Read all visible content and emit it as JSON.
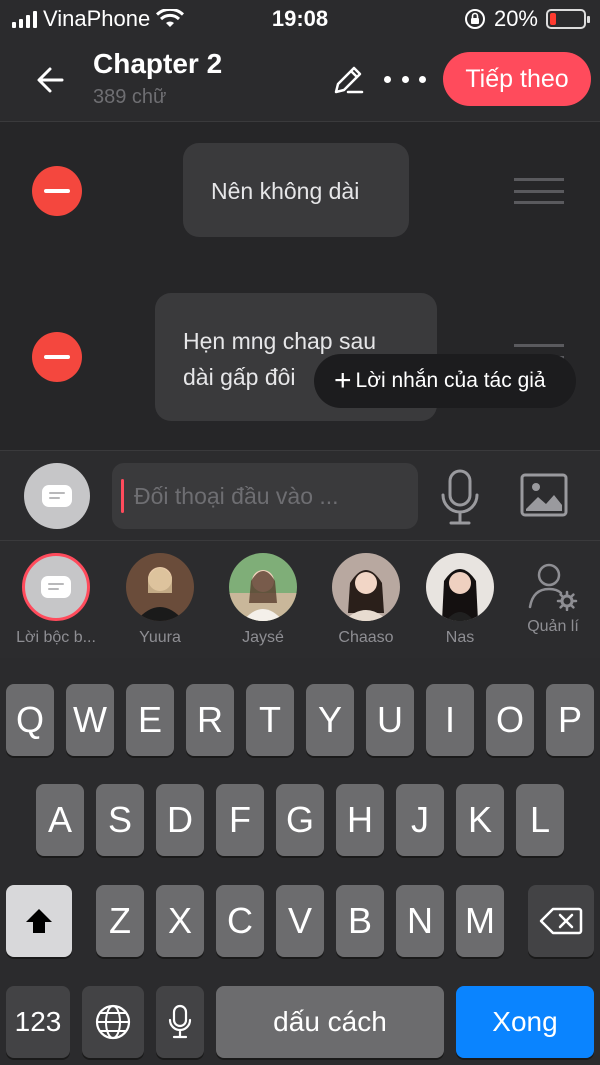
{
  "status_bar": {
    "carrier": "VinaPhone",
    "time": "19:08",
    "battery": "20%",
    "battery_level": 0.2,
    "colors": {
      "battery_low": "#ff3b30"
    }
  },
  "header": {
    "title": "Chapter 2",
    "word_count": "389 chữ",
    "next_label": "Tiếp theo",
    "accent": "#ff4b5c"
  },
  "messages": [
    {
      "text": "Nên không dài"
    },
    {
      "line1": "Hẹn mng chap sau",
      "line2": "dài gấp đôi"
    }
  ],
  "tooltip": {
    "plus": "+",
    "label": "Lời nhắn của tác giả"
  },
  "composer": {
    "placeholder": "Đối thoại đầu vào ..."
  },
  "characters": [
    {
      "name": "Lời bộc b..."
    },
    {
      "name": "Yuura"
    },
    {
      "name": "Jaysé"
    },
    {
      "name": "Chaaso"
    },
    {
      "name": "Nas"
    }
  ],
  "manage_label": "Quản lí",
  "keyboard": {
    "row1": [
      "Q",
      "W",
      "E",
      "R",
      "T",
      "Y",
      "U",
      "I",
      "O",
      "P"
    ],
    "row2": [
      "A",
      "S",
      "D",
      "F",
      "G",
      "H",
      "J",
      "K",
      "L"
    ],
    "row3": [
      "Z",
      "X",
      "C",
      "V",
      "B",
      "N",
      "M"
    ],
    "numbers_key": "123",
    "space_key": "dấu cách",
    "done_key": "Xong"
  },
  "icons": [
    "back-arrow-icon",
    "edit-pencil-icon",
    "more-dots-icon",
    "microphone-icon",
    "image-icon",
    "manage-person-gear-icon",
    "shift-icon",
    "backspace-icon",
    "globe-icon"
  ]
}
